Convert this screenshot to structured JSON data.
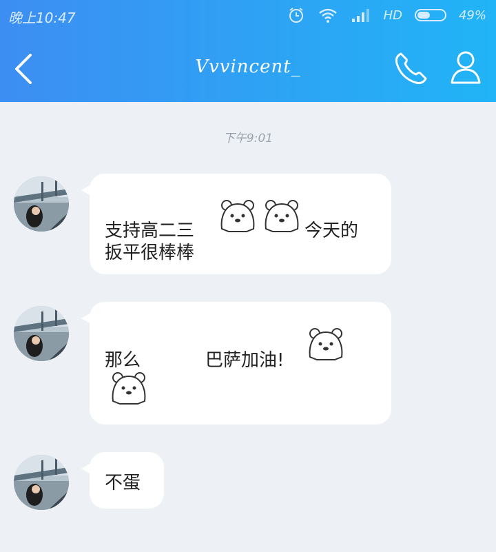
{
  "status_bar": {
    "time": "晚上10:47",
    "network": "HD",
    "battery": "49%"
  },
  "header": {
    "title": "Vvvincent_"
  },
  "chat": {
    "timestamp": "下午9:01",
    "messages": [
      {
        "segments": [
          "支持高二三",
          "今天的",
          "扳平很棒棒"
        ]
      },
      {
        "segments": [
          "那么",
          "巴萨加油!"
        ]
      },
      {
        "segments": [
          "不蛋"
        ]
      }
    ]
  },
  "icons": {
    "back": "back-arrow-icon",
    "call": "phone-icon",
    "profile": "person-icon",
    "emoji": "polar-bear-emoji-icon"
  },
  "colors": {
    "header_start": "#3d8ef2",
    "header_end": "#21b4f6",
    "background": "#edf1f6",
    "bubble": "#ffffff"
  }
}
